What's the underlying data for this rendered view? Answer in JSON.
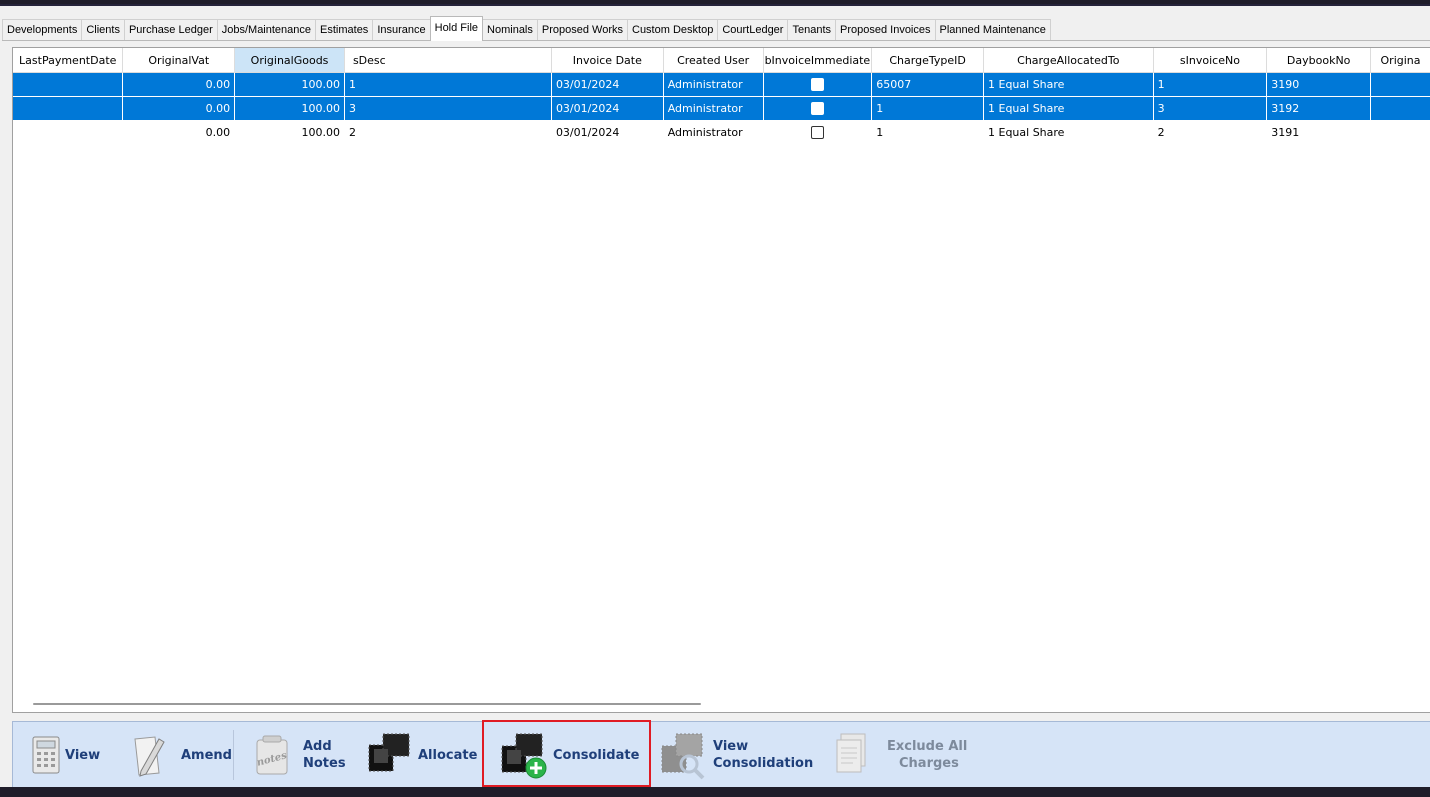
{
  "tabs": [
    "Developments",
    "Clients",
    "Purchase Ledger",
    "Jobs/Maintenance",
    "Estimates",
    "Insurance",
    "Hold File",
    "Nominals",
    "Proposed Works",
    "Custom Desktop",
    "CourtLedger",
    "Tenants",
    "Proposed Invoices",
    "Planned Maintenance"
  ],
  "active_tab": "Hold File",
  "grid": {
    "columns": [
      "LastPaymentDate",
      "OriginalVat",
      "OriginalGoods",
      "sDesc",
      "Invoice Date",
      "Created User",
      "bInvoiceImmediate",
      "ChargeTypeID",
      "ChargeAllocatedTo",
      "sInvoiceNo",
      "DaybookNo",
      "Origina"
    ],
    "rows": [
      {
        "LastPaymentDate": "",
        "OriginalVat": "0.00",
        "OriginalGoods": "100.00",
        "sDesc": "1",
        "InvoiceDate": "03/01/2024",
        "CreatedUser": "Administrator",
        "bInvoiceImmediate": false,
        "ChargeTypeID": "65007",
        "ChargeAllocatedTo": "1  Equal Share",
        "sInvoiceNo": "1",
        "DaybookNo": "3190",
        "selected": true
      },
      {
        "LastPaymentDate": "",
        "OriginalVat": "0.00",
        "OriginalGoods": "100.00",
        "sDesc": "3",
        "InvoiceDate": "03/01/2024",
        "CreatedUser": "Administrator",
        "bInvoiceImmediate": false,
        "ChargeTypeID": "1",
        "ChargeAllocatedTo": "1  Equal Share",
        "sInvoiceNo": "3",
        "DaybookNo": "3192",
        "selected": true
      },
      {
        "LastPaymentDate": "",
        "OriginalVat": "0.00",
        "OriginalGoods": "100.00",
        "sDesc": "2",
        "InvoiceDate": "03/01/2024",
        "CreatedUser": "Administrator",
        "bInvoiceImmediate": false,
        "ChargeTypeID": "1",
        "ChargeAllocatedTo": "1  Equal Share",
        "sInvoiceNo": "2",
        "DaybookNo": "3191",
        "selected": false
      }
    ]
  },
  "toolbar": {
    "view": "View",
    "amend": "Amend",
    "add_notes_1": "Add",
    "add_notes_2": "Notes",
    "allocate": "Allocate",
    "consolidate": "Consolidate",
    "view_consolidation_1": "View",
    "view_consolidation_2": "Consolidation",
    "exclude_all_1": "Exclude All",
    "exclude_all_2": "Charges"
  }
}
